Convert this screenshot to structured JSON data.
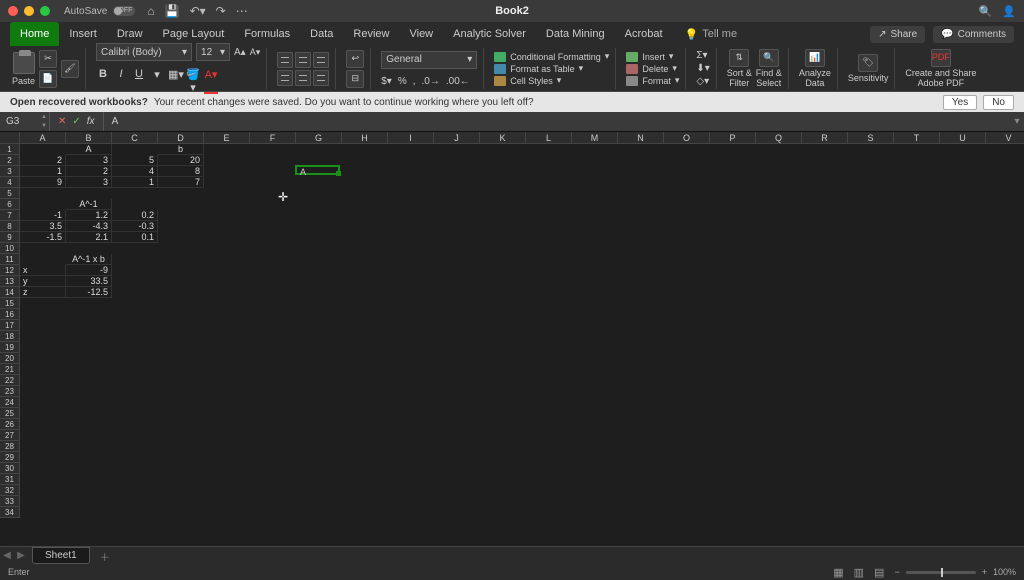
{
  "titlebar": {
    "autosave": "AutoSave",
    "autosave_state": "OFF",
    "doc_title": "Book2"
  },
  "ribbon_tabs": [
    "Home",
    "Insert",
    "Draw",
    "Page Layout",
    "Formulas",
    "Data",
    "Review",
    "View",
    "Analytic Solver",
    "Data Mining",
    "Acrobat"
  ],
  "tell_me": "Tell me",
  "share_label": "Share",
  "comments_label": "Comments",
  "clipboard": {
    "paste": "Paste"
  },
  "font": {
    "name": "Calibri (Body)",
    "size": "12",
    "bold": "B",
    "italic": "I",
    "underline": "U"
  },
  "number_format": "General",
  "styles": {
    "cond": "Conditional Formatting",
    "table": "Format as Table",
    "cell": "Cell Styles"
  },
  "cells_group": {
    "insert": "Insert",
    "delete": "Delete",
    "format": "Format"
  },
  "editing": {
    "sort": "Sort &\nFilter",
    "find": "Find &\nSelect",
    "analyze": "Analyze\nData",
    "sens": "Sensitivity",
    "adobe": "Create and Share\nAdobe PDF"
  },
  "msgbar": {
    "bold": "Open recovered workbooks?",
    "text": "Your recent changes were saved. Do you want to continue working where you left off?",
    "yes": "Yes",
    "no": "No"
  },
  "fx": {
    "cellref": "G3",
    "formula": "A"
  },
  "columns": [
    "A",
    "B",
    "C",
    "D",
    "E",
    "F",
    "G",
    "H",
    "I",
    "J",
    "K",
    "L",
    "M",
    "N",
    "O",
    "P",
    "Q",
    "R",
    "S",
    "T",
    "U",
    "V"
  ],
  "row_count": 34,
  "cell_data": {
    "B1": {
      "v": "A",
      "align": "c"
    },
    "D1": {
      "v": "b",
      "align": "c"
    },
    "A2": {
      "v": "2"
    },
    "B2": {
      "v": "3"
    },
    "C2": {
      "v": "5"
    },
    "D2": {
      "v": "20"
    },
    "A3": {
      "v": "1"
    },
    "B3": {
      "v": "2"
    },
    "C3": {
      "v": "4"
    },
    "D3": {
      "v": "8"
    },
    "A4": {
      "v": "9"
    },
    "B4": {
      "v": "3"
    },
    "C4": {
      "v": "1"
    },
    "D4": {
      "v": "7"
    },
    "B6": {
      "v": "A^-1",
      "align": "c"
    },
    "A7": {
      "v": "-1"
    },
    "B7": {
      "v": "1.2"
    },
    "C7": {
      "v": "0.2"
    },
    "A8": {
      "v": "3.5"
    },
    "B8": {
      "v": "-4.3"
    },
    "C8": {
      "v": "-0.3"
    },
    "A9": {
      "v": "-1.5"
    },
    "B9": {
      "v": "2.1"
    },
    "C9": {
      "v": "0.1"
    },
    "B11": {
      "v": "A^-1 x b",
      "align": "c"
    },
    "A12": {
      "v": "x",
      "align": "l"
    },
    "B12": {
      "v": "-9"
    },
    "A13": {
      "v": "y",
      "align": "l"
    },
    "B13": {
      "v": "33.5"
    },
    "A14": {
      "v": "z",
      "align": "l"
    },
    "B14": {
      "v": "-12.5"
    }
  },
  "active_cell": {
    "col": "G",
    "row": 3,
    "text": "A"
  },
  "sheets": {
    "name": "Sheet1"
  },
  "status": {
    "mode": "Enter",
    "zoom": "100%"
  }
}
